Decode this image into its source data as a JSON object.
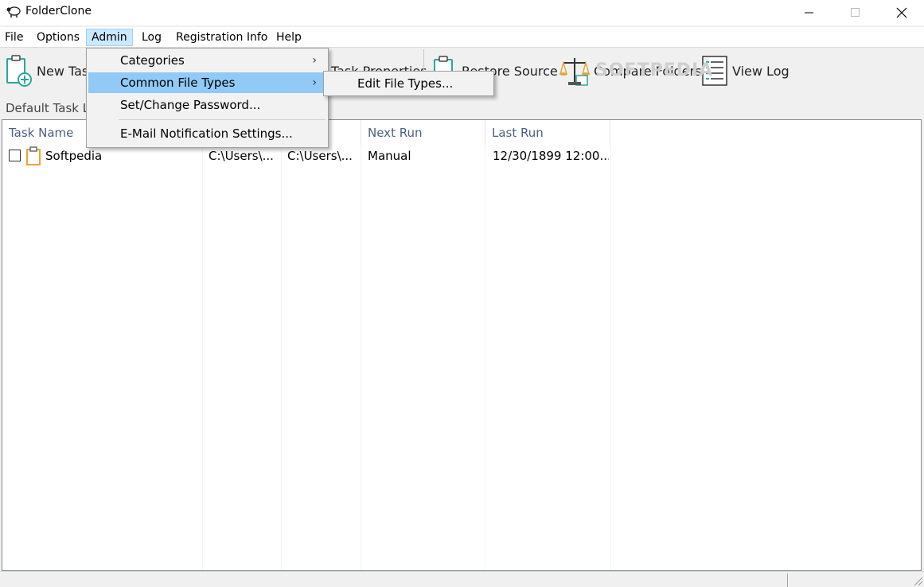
{
  "window": {
    "title": "FolderClone"
  },
  "menubar": {
    "items": [
      {
        "label": "File"
      },
      {
        "label": "Options"
      },
      {
        "label": "Admin"
      },
      {
        "label": "Log"
      },
      {
        "label": "Registration Info"
      },
      {
        "label": "Help"
      }
    ]
  },
  "toolbar": {
    "new_task": "New Task",
    "task_properties": "Task Properties",
    "restore_source": "Restore Source",
    "compare_folders": "Compare Folders",
    "view_log": "View Log"
  },
  "watermark": "SOFTPEDIA",
  "task_tab": {
    "label": "Default Task List"
  },
  "list": {
    "columns": [
      "Task Name",
      "",
      "",
      "Next Run",
      "Last Run"
    ],
    "rows": [
      {
        "name": "Softpedia",
        "source": "C:\\Users\\...",
        "destination": "C:\\Users\\...",
        "next_run": "Manual",
        "last_run": "12/30/1899 12:00..."
      }
    ]
  },
  "admin_menu": {
    "items": [
      "Categories",
      "Common File Types",
      "Set/Change Password...",
      "E-Mail Notification Settings..."
    ],
    "submenu": [
      "Edit File Types..."
    ]
  },
  "colors": {
    "menu_highlight": "#91c9f7",
    "menubar_active": "#cce8ff",
    "header_text": "#4d6082",
    "icon_orange": "#e8a33c",
    "icon_teal": "#2aa89a"
  }
}
